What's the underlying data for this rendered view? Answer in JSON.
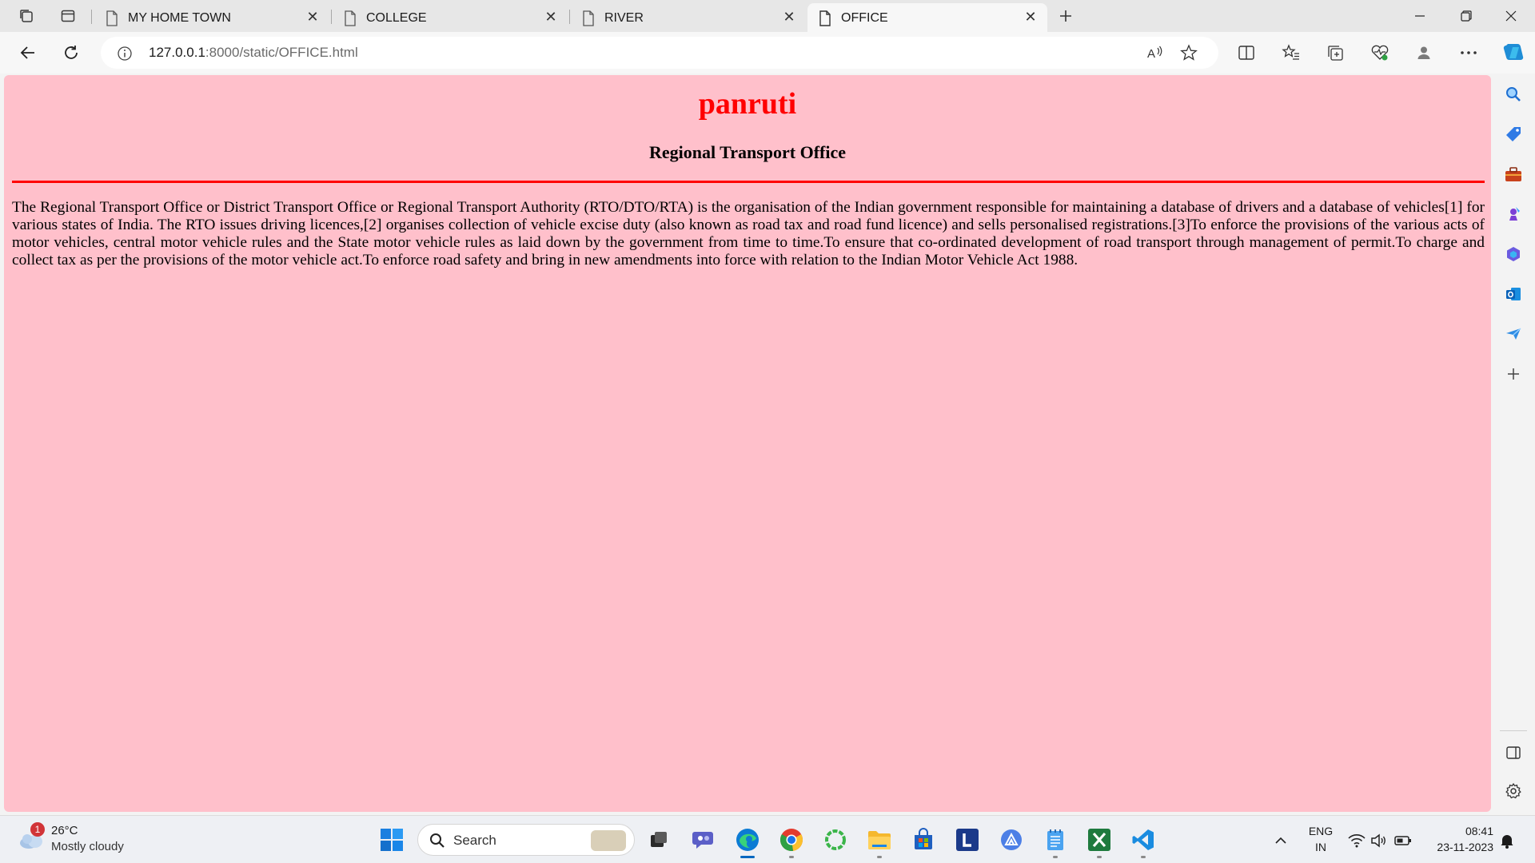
{
  "browser": {
    "tabs": [
      {
        "title": "MY HOME TOWN",
        "active": false
      },
      {
        "title": "COLLEGE",
        "active": false
      },
      {
        "title": "RIVER",
        "active": false
      },
      {
        "title": "OFFICE",
        "active": true
      }
    ],
    "new_tab_icon": "plus-icon",
    "address": {
      "host": "127.0.0.1",
      "path": ":8000/static/OFFICE.html"
    }
  },
  "page": {
    "background": "#ffc0cb",
    "accent": "#ff0000",
    "heading": "panruti",
    "subheading": "Regional Transport Office",
    "paragraph": "The Regional Transport Office or District Transport Office or Regional Transport Authority (RTO/DTO/RTA) is the organisation of the Indian government responsible for maintaining a database of drivers and a database of vehicles[1] for various states of India. The RTO issues driving licences,[2] organises collection of vehicle excise duty (also known as road tax and road fund licence) and sells personalised registrations.[3]To enforce the provisions of the various acts of motor vehicles, central motor vehicle rules and the State motor vehicle rules as laid down by the government from time to time.To ensure that co-ordinated development of road transport through management of permit.To charge and collect tax as per the provisions of the motor vehicle act.To enforce road safety and bring in new amendments into force with relation to the Indian Motor Vehicle Act 1988."
  },
  "taskbar": {
    "weather": {
      "badge": "1",
      "temp": "26°C",
      "desc": "Mostly cloudy"
    },
    "search_label": "Search",
    "language": {
      "line1": "ENG",
      "line2": "IN"
    },
    "clock": {
      "time": "08:41",
      "date": "23-11-2023"
    }
  }
}
